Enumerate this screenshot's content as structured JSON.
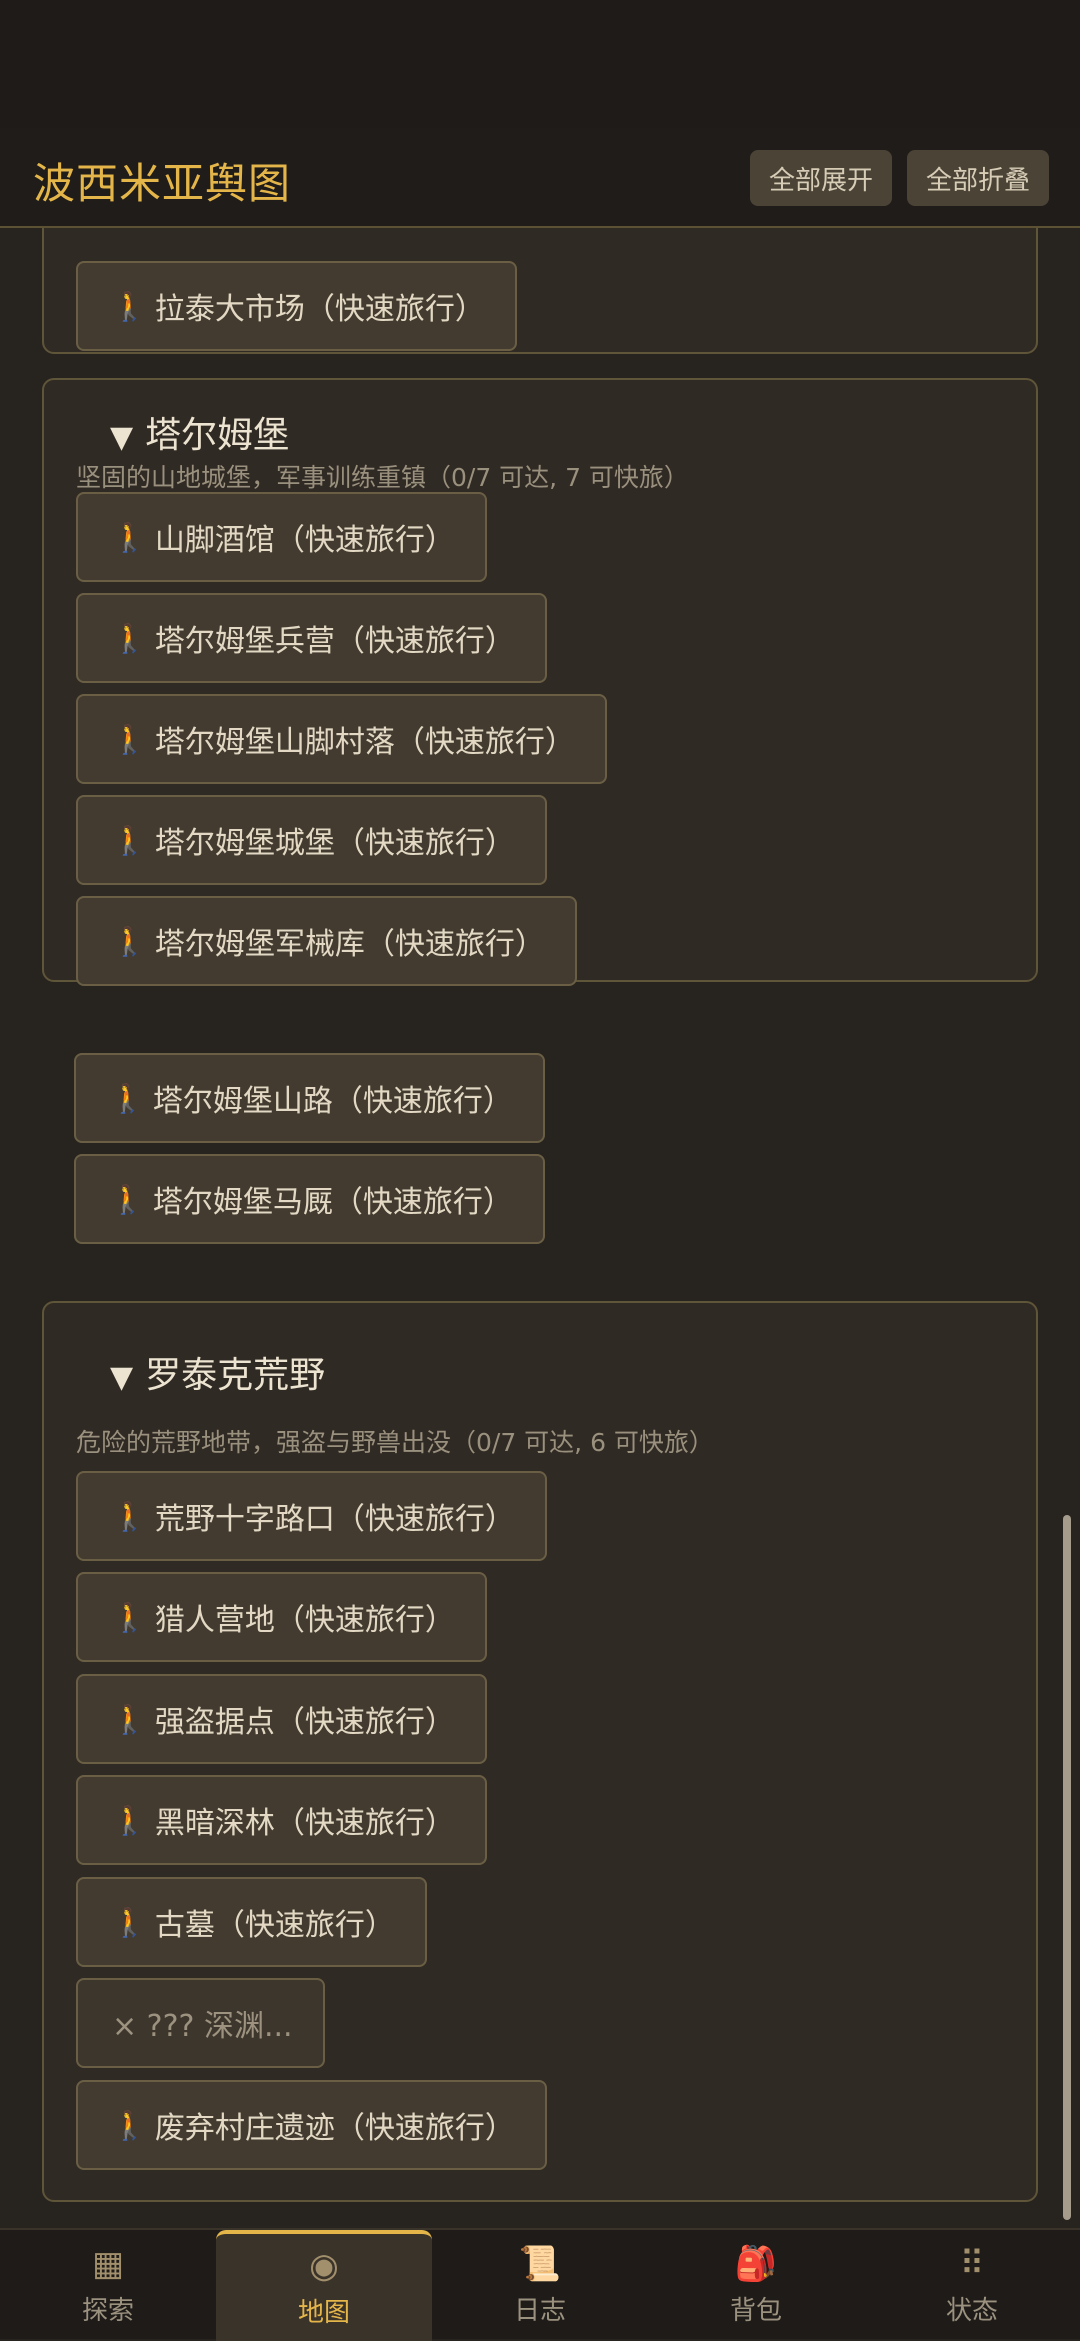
{
  "header": {
    "title": "波西米亚舆图",
    "expand_all": "全部展开",
    "collapse_all": "全部折叠"
  },
  "sections": [
    {
      "locations": [
        "拉泰大市场（快速旅行）"
      ]
    },
    {
      "name": "塔尔姆堡",
      "toggle": "▼",
      "description": "坚固的山地城堡，军事训练重镇（0/7 可达, 7 可快旅）",
      "locations": [
        "山脚酒馆（快速旅行）",
        "塔尔姆堡兵营（快速旅行）",
        "塔尔姆堡山脚村落（快速旅行）",
        "塔尔姆堡城堡（快速旅行）",
        "塔尔姆堡军械库（快速旅行）",
        "塔尔姆堡山路（快速旅行）",
        "塔尔姆堡马厩（快速旅行）"
      ]
    },
    {
      "name": "罗泰克荒野",
      "toggle": "▼",
      "description": "危险的荒野地带，强盗与野兽出没（0/7 可达, 6 可快旅）",
      "locations": [
        "荒野十字路口（快速旅行）",
        "猎人营地（快速旅行）",
        "强盗据点（快速旅行）",
        "黑暗深林（快速旅行）",
        "古墓（快速旅行）",
        "× ??? 深渊...",
        "废弃村庄遗迹（快速旅行）"
      ]
    }
  ],
  "tabs": [
    {
      "label": "探索",
      "icon": "grid-icon"
    },
    {
      "label": "地图",
      "icon": "compass-icon",
      "active": true
    },
    {
      "label": "日志",
      "icon": "scroll-icon"
    },
    {
      "label": "背包",
      "icon": "backpack-icon"
    },
    {
      "label": "状态",
      "icon": "stats-icon"
    }
  ],
  "colors": {
    "accent": "#e4b64a",
    "background": "#27231e",
    "card": "#302a24",
    "button": "#433b30"
  }
}
